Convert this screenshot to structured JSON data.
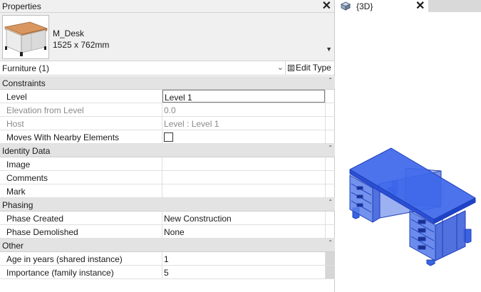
{
  "properties": {
    "title": "Properties",
    "type_name": "M_Desk",
    "type_size": "1525 x 762mm",
    "filter_label": "Furniture (1)",
    "edit_type_label": "Edit Type",
    "groups": [
      {
        "label": "Constraints",
        "rows": [
          {
            "name": "Level",
            "value": "Level 1"
          },
          {
            "name": "Elevation from Level",
            "value": "0.0"
          },
          {
            "name": "Host",
            "value": "Level : Level 1"
          },
          {
            "name": "Moves With Nearby Elements",
            "value": ""
          }
        ]
      },
      {
        "label": "Identity Data",
        "rows": [
          {
            "name": "Image",
            "value": ""
          },
          {
            "name": "Comments",
            "value": ""
          },
          {
            "name": "Mark",
            "value": ""
          }
        ]
      },
      {
        "label": "Phasing",
        "rows": [
          {
            "name": "Phase Created",
            "value": "New Construction"
          },
          {
            "name": "Phase Demolished",
            "value": "None"
          }
        ]
      },
      {
        "label": "Other",
        "rows": [
          {
            "name": "Age in years (shared instance)",
            "value": "1"
          },
          {
            "name": "Importance (family instance)",
            "value": "5"
          }
        ]
      }
    ]
  },
  "view": {
    "tab_label": "{3D}",
    "model_color": "#2f5fe0"
  }
}
